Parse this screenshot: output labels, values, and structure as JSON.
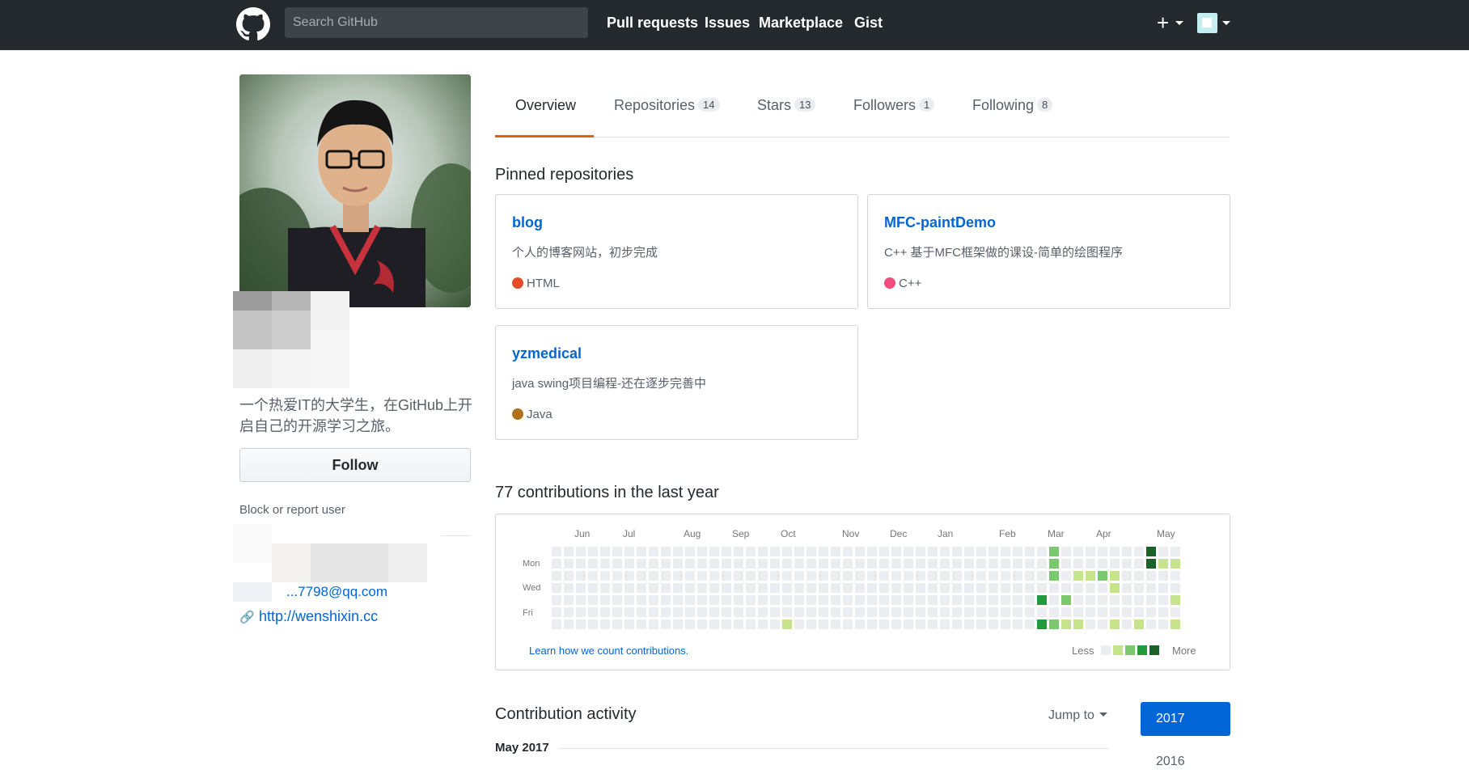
{
  "header": {
    "search_placeholder": "Search GitHub",
    "nav": [
      "Pull requests",
      "Issues",
      "Marketplace",
      "Gist"
    ],
    "plus_label": "+"
  },
  "profile": {
    "bio": "一个热爱IT的大学生，在GitHub上开启自己的开源学习之旅。",
    "follow_label": "Follow",
    "block_label": "Block or report user",
    "email_fragment": "...7798@qq.com",
    "url": "http://wenshixin.cc"
  },
  "tabs": [
    {
      "label": "Overview",
      "count": null,
      "active": true
    },
    {
      "label": "Repositories",
      "count": "14"
    },
    {
      "label": "Stars",
      "count": "13"
    },
    {
      "label": "Followers",
      "count": "1"
    },
    {
      "label": "Following",
      "count": "8"
    }
  ],
  "pinned": {
    "title": "Pinned repositories",
    "repos": [
      {
        "name": "blog",
        "description": "个人的博客网站，初步完成",
        "language": "HTML",
        "color": "#e34c26"
      },
      {
        "name": "MFC-paintDemo",
        "description": "C++ 基于MFC框架做的课设-简单的绘图程序",
        "language": "C++",
        "color": "#f34b7d"
      },
      {
        "name": "yzmedical",
        "description": "java swing项目编程-还在逐步完善中",
        "language": "Java",
        "color": "#b07219"
      }
    ]
  },
  "contributions": {
    "title": "77 contributions in the last year",
    "months": [
      "Jun",
      "Jul",
      "Aug",
      "Sep",
      "Oct",
      "Nov",
      "Dec",
      "Jan",
      "Feb",
      "Mar",
      "Apr",
      "May"
    ],
    "days": [
      "Mon",
      "Wed",
      "Fri"
    ],
    "learn_link": "Learn how we count contributions.",
    "legend_less": "Less",
    "legend_more": "More",
    "colors": [
      "#ebedf0",
      "#c6e48b",
      "#7bc96f",
      "#239a3b",
      "#196127"
    ]
  },
  "activity": {
    "title": "Contribution activity",
    "jump_label": "Jump to",
    "years": [
      "2017",
      "2016"
    ],
    "month_label": "May 2017"
  }
}
